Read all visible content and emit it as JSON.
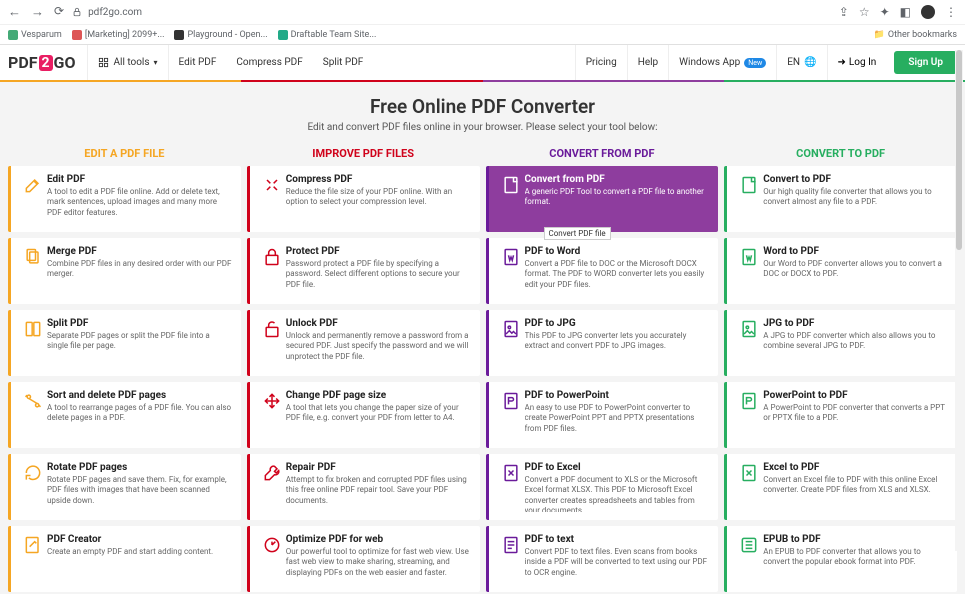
{
  "browser": {
    "url": "pdf2go.com",
    "bookmarks": [
      "Vesparum",
      "[Marketing] 2099+...",
      "Playground - Open...",
      "Draftable Team Site..."
    ],
    "other_bookmarks": "Other bookmarks"
  },
  "header": {
    "logo": {
      "p1": "PDF",
      "p2": "2",
      "p3": "GO"
    },
    "all_tools": "All tools",
    "nav": [
      "Edit PDF",
      "Compress PDF",
      "Split PDF"
    ],
    "right": {
      "pricing": "Pricing",
      "help": "Help",
      "windows": "Windows App",
      "new_badge": "New",
      "lang": "EN",
      "login": "Log In",
      "signup": "Sign Up"
    }
  },
  "hero": {
    "title": "Free Online PDF Converter",
    "subtitle": "Edit and convert PDF files online in your browser. Please select your tool below:"
  },
  "columns": {
    "titles": [
      "EDIT A PDF FILE",
      "IMPROVE PDF FILES",
      "CONVERT FROM PDF",
      "CONVERT TO PDF"
    ],
    "c1": [
      {
        "title": "Edit PDF",
        "desc": "A tool to edit a PDF file online. Add or delete text, mark sentences, upload images and many more PDF editor features."
      },
      {
        "title": "Merge PDF",
        "desc": "Combine PDF files in any desired order with our PDF merger."
      },
      {
        "title": "Split PDF",
        "desc": "Separate PDF pages or split the PDF file into a single file per page."
      },
      {
        "title": "Sort and delete PDF pages",
        "desc": "A tool to rearrange pages of a PDF file. You can also delete pages in a PDF."
      },
      {
        "title": "Rotate PDF pages",
        "desc": "Rotate PDF pages and save them. Fix, for example, PDF files with images that have been scanned upside down."
      },
      {
        "title": "PDF Creator",
        "desc": "Create an empty PDF and start adding content."
      }
    ],
    "c2": [
      {
        "title": "Compress PDF",
        "desc": "Reduce the file size of your PDF online. With an option to select your compression level."
      },
      {
        "title": "Protect PDF",
        "desc": "Password protect a PDF file by specifying a password. Select different options to secure your PDF file."
      },
      {
        "title": "Unlock PDF",
        "desc": "Unlock and permanently remove a password from a secured PDF. Just specify the password and we will unprotect the PDF file."
      },
      {
        "title": "Change PDF page size",
        "desc": "A tool that lets you change the paper size of your PDF file, e.g. convert your PDF from letter to A4."
      },
      {
        "title": "Repair PDF",
        "desc": "Attempt to fix broken and corrupted PDF files using this free online PDF repair tool. Save your PDF documents."
      },
      {
        "title": "Optimize PDF for web",
        "desc": "Our powerful tool to optimize for fast web view. Use fast web view to make sharing, streaming, and displaying PDFs on the web easier and faster."
      }
    ],
    "c3": [
      {
        "title": "Convert from PDF",
        "desc": "A generic PDF Tool to convert a PDF file to another format.",
        "active": true,
        "tooltip": "Convert PDF file"
      },
      {
        "title": "PDF to Word",
        "desc": "Convert a PDF file to DOC or the Microsoft DOCX format. The PDF to WORD converter lets you easily edit your PDF files."
      },
      {
        "title": "PDF to JPG",
        "desc": "This PDF to JPG converter lets you accurately extract and convert PDF to JPG images."
      },
      {
        "title": "PDF to PowerPoint",
        "desc": "An easy to use PDF to PowerPoint converter to create PowerPoint PPT and PPTX presentations from PDF files."
      },
      {
        "title": "PDF to Excel",
        "desc": "Convert a PDF document to XLS or the Microsoft Excel format XLSX. This PDF to Microsoft Excel converter creates spreadsheets and tables from your documents."
      },
      {
        "title": "PDF to text",
        "desc": "Convert PDF to text files. Even scans from books inside a PDF will be converted to text using our PDF to OCR engine."
      }
    ],
    "c4": [
      {
        "title": "Convert to PDF",
        "desc": "Our high quality file converter that allows you to convert almost any file to a PDF."
      },
      {
        "title": "Word to PDF",
        "desc": "Our Word to PDF converter allows you to convert a DOC or DOCX to PDF."
      },
      {
        "title": "JPG to PDF",
        "desc": "A JPG to PDF converter which also allows you to combine several JPG to PDF."
      },
      {
        "title": "PowerPoint to PDF",
        "desc": "A PowerPoint to PDF converter that converts a PPT or PPTX file to a PDF."
      },
      {
        "title": "Excel to PDF",
        "desc": "Convert an Excel file to PDF with this online Excel converter. Create PDF files from XLS and XLSX."
      },
      {
        "title": "EPUB to PDF",
        "desc": "An EPUB to PDF converter that allows you to convert the popular ebook format into PDF."
      }
    ]
  }
}
